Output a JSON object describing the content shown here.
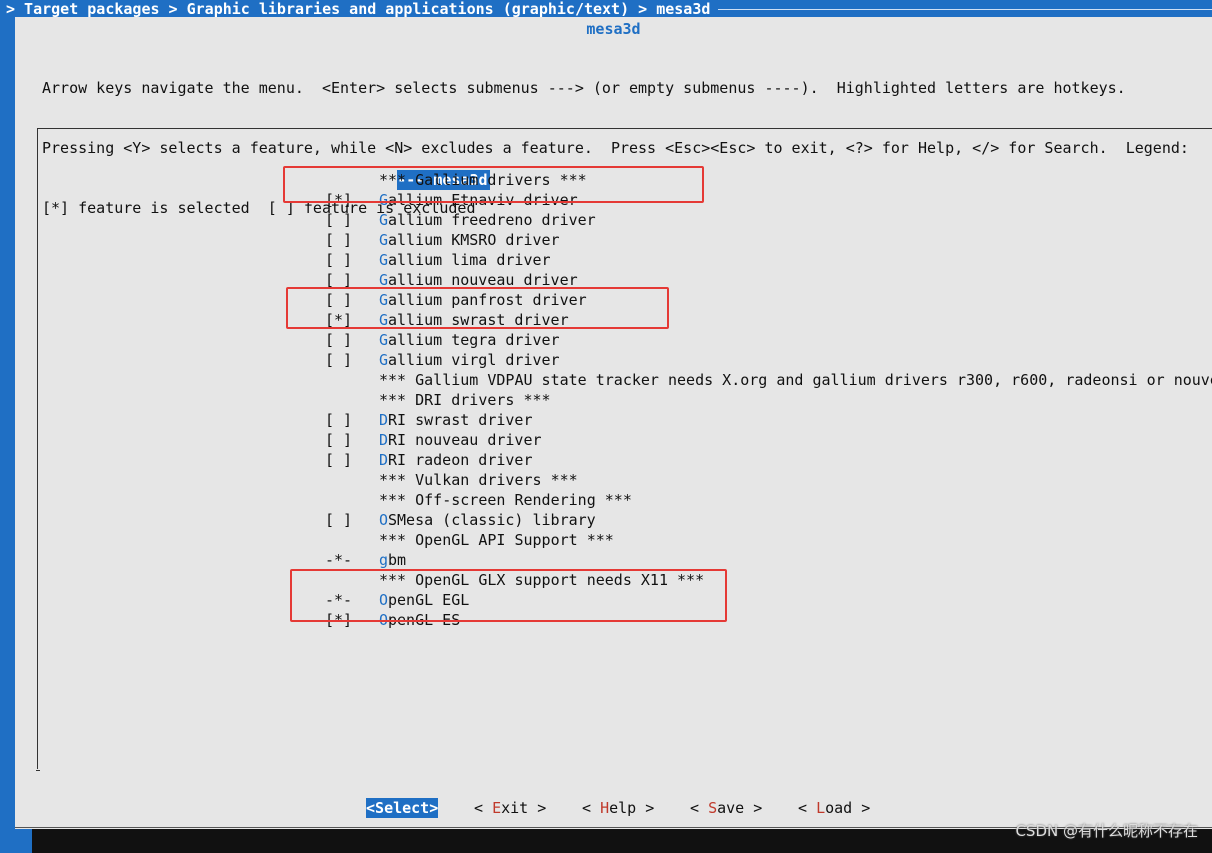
{
  "breadcrumb": "> Target packages > Graphic libraries and applications (graphic/text) > mesa3d",
  "dialog": {
    "title": "mesa3d",
    "help_lines": [
      "Arrow keys navigate the menu.  <Enter> selects submenus ---> (or empty submenus ----).  Highlighted letters are hotkeys.",
      "Pressing <Y> selects a feature, while <N> excludes a feature.  Press <Esc><Esc> to exit, <?> for Help, </> for Search.  Legend:",
      "[*] feature is selected  [ ] feature is excluded"
    ]
  },
  "menu": {
    "header_mark": "---",
    "header_label": " mesa3d",
    "items": [
      {
        "mark": "",
        "hk": "",
        "rest": "",
        "comment": "*** Gallium drivers ***"
      },
      {
        "mark": "[*]",
        "hk": "G",
        "rest": "allium Etnaviv driver",
        "comment": ""
      },
      {
        "mark": "[ ]",
        "hk": "G",
        "rest": "allium freedreno driver",
        "comment": ""
      },
      {
        "mark": "[ ]",
        "hk": "G",
        "rest": "allium KMSRO driver",
        "comment": ""
      },
      {
        "mark": "[ ]",
        "hk": "G",
        "rest": "allium lima driver",
        "comment": ""
      },
      {
        "mark": "[ ]",
        "hk": "G",
        "rest": "allium nouveau driver",
        "comment": ""
      },
      {
        "mark": "[ ]",
        "hk": "G",
        "rest": "allium panfrost driver",
        "comment": ""
      },
      {
        "mark": "[*]",
        "hk": "G",
        "rest": "allium swrast driver",
        "comment": ""
      },
      {
        "mark": "[ ]",
        "hk": "G",
        "rest": "allium tegra driver",
        "comment": ""
      },
      {
        "mark": "[ ]",
        "hk": "G",
        "rest": "allium virgl driver",
        "comment": ""
      },
      {
        "mark": "",
        "hk": "",
        "rest": "",
        "comment": "*** Gallium VDPAU state tracker needs X.org and gallium drivers r300, r600, radeonsi or nouve"
      },
      {
        "mark": "",
        "hk": "",
        "rest": "",
        "comment": "*** DRI drivers ***"
      },
      {
        "mark": "[ ]",
        "hk": "D",
        "rest": "RI swrast driver",
        "comment": ""
      },
      {
        "mark": "[ ]",
        "hk": "D",
        "rest": "RI nouveau driver",
        "comment": ""
      },
      {
        "mark": "[ ]",
        "hk": "D",
        "rest": "RI radeon driver",
        "comment": ""
      },
      {
        "mark": "",
        "hk": "",
        "rest": "",
        "comment": "*** Vulkan drivers ***"
      },
      {
        "mark": "",
        "hk": "",
        "rest": "",
        "comment": "*** Off-screen Rendering ***"
      },
      {
        "mark": "[ ]",
        "hk": "O",
        "rest": "SMesa (classic) library",
        "comment": ""
      },
      {
        "mark": "",
        "hk": "",
        "rest": "",
        "comment": "*** OpenGL API Support ***"
      },
      {
        "mark": "-*-",
        "hk": "g",
        "rest": "bm",
        "comment": ""
      },
      {
        "mark": "",
        "hk": "",
        "rest": "",
        "comment": "*** OpenGL GLX support needs X11 ***"
      },
      {
        "mark": "-*-",
        "hk": "O",
        "rest": "penGL EGL",
        "comment": ""
      },
      {
        "mark": "[*]",
        "hk": "O",
        "rest": "penGL ES",
        "comment": ""
      }
    ]
  },
  "buttons": [
    {
      "pre": "<",
      "key": "S",
      "post": "elect>",
      "selected": true
    },
    {
      "pre": "< ",
      "key": "E",
      "post": "xit >",
      "selected": false
    },
    {
      "pre": "< ",
      "key": "H",
      "post": "elp >",
      "selected": false
    },
    {
      "pre": "< ",
      "key": "S",
      "post": "ave >",
      "selected": false
    },
    {
      "pre": "< ",
      "key": "L",
      "post": "oad >",
      "selected": false
    }
  ],
  "watermark": "CSDN @有什么昵称不存在",
  "colors": {
    "accent": "#1f6fc4",
    "dialog_bg": "#e6e6e6",
    "annotation": "#e53935"
  }
}
